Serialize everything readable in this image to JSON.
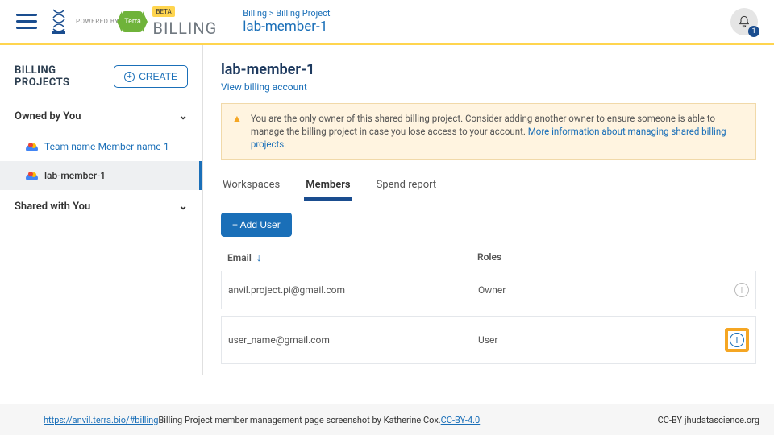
{
  "header": {
    "powered_by": "POWERED BY",
    "terra_label": "Terra",
    "beta_label": "BETA",
    "app_title": "BILLING",
    "breadcrumb": "Billing > Billing Project",
    "project_name": "lab-member-1",
    "notif_count": "1"
  },
  "sidebar": {
    "title": "BILLING PROJECTS",
    "create_label": "CREATE",
    "owned_label": "Owned by You",
    "shared_label": "Shared with You",
    "projects": [
      {
        "name": "Team-name-Member-name-1"
      },
      {
        "name": "lab-member-1"
      }
    ]
  },
  "main": {
    "title": "lab-member-1",
    "view_account": "View billing account",
    "notice_text": "You are the only owner of this shared billing project. Consider adding another owner to ensure someone is able to manage the billing project in case you lose access to your account. ",
    "notice_link": "More information about managing shared billing projects.",
    "tabs": {
      "workspaces": "Workspaces",
      "members": "Members",
      "spend": "Spend report"
    },
    "add_user": "+  Add User",
    "col_email": "Email",
    "col_roles": "Roles",
    "rows": [
      {
        "email": "anvil.project.pi@gmail.com",
        "role": "Owner"
      },
      {
        "email": "user_name@gmail.com",
        "role": "User"
      }
    ]
  },
  "footer": {
    "url": "https://anvil.terra.bio/#billing",
    "caption": " Billing Project member management page screenshot by Katherine Cox.  ",
    "license": "CC-BY-4.0",
    "right": "CC-BY  jhudatascience.org"
  }
}
